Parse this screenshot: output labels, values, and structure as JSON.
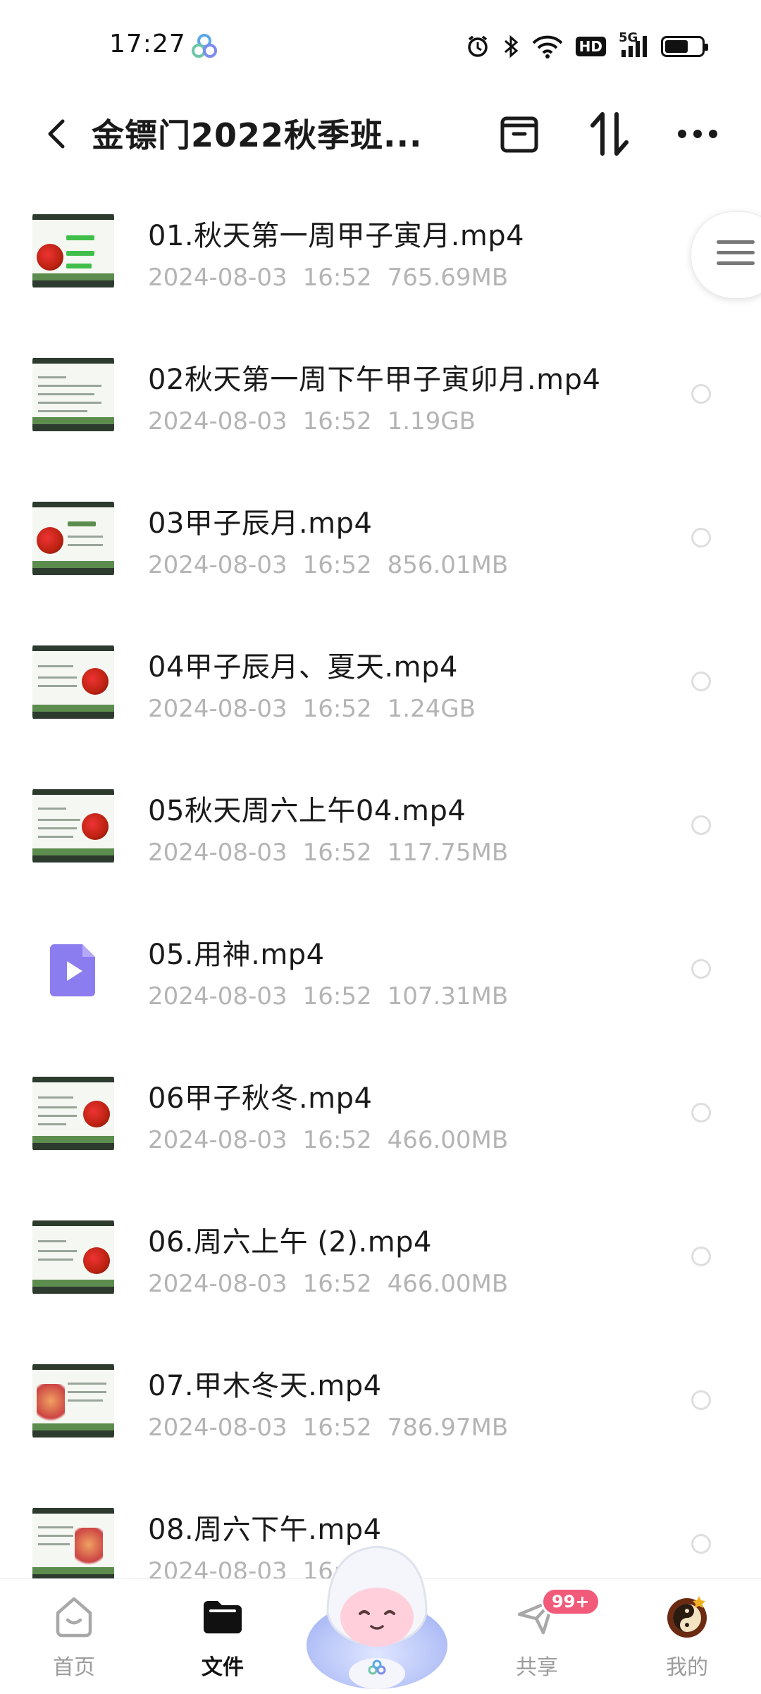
{
  "status_bar": {
    "time": "17:27",
    "network": "5G",
    "hd_label": "HD",
    "icons": [
      "alarm-icon",
      "bluetooth-icon",
      "wifi-icon",
      "hd-icon",
      "signal-icon",
      "battery-icon"
    ]
  },
  "header": {
    "title": "金镖门2022秋季班...",
    "buttons": [
      "back-icon",
      "archive-icon",
      "sort-icon",
      "more-icon"
    ]
  },
  "files": [
    {
      "name": "01.秋天第一周甲子寅月.mp4",
      "date": "2024-08-03",
      "time": "16:52",
      "size": "765.69MB",
      "thumb": "slide"
    },
    {
      "name": "02秋天第一周下午甲子寅卯月.mp4",
      "date": "2024-08-03",
      "time": "16:52",
      "size": "1.19GB",
      "thumb": "slide"
    },
    {
      "name": "03甲子辰月.mp4",
      "date": "2024-08-03",
      "time": "16:52",
      "size": "856.01MB",
      "thumb": "slide"
    },
    {
      "name": "04甲子辰月、夏天.mp4",
      "date": "2024-08-03",
      "time": "16:52",
      "size": "1.24GB",
      "thumb": "slide"
    },
    {
      "name": "05秋天周六上午04.mp4",
      "date": "2024-08-03",
      "time": "16:52",
      "size": "117.75MB",
      "thumb": "slide"
    },
    {
      "name": "05.用神.mp4",
      "date": "2024-08-03",
      "time": "16:52",
      "size": "107.31MB",
      "thumb": "video-icon"
    },
    {
      "name": "06甲子秋冬.mp4",
      "date": "2024-08-03",
      "time": "16:52",
      "size": "466.00MB",
      "thumb": "slide"
    },
    {
      "name": "06.周六上午 (2).mp4",
      "date": "2024-08-03",
      "time": "16:52",
      "size": "466.00MB",
      "thumb": "slide"
    },
    {
      "name": "07.甲木冬天.mp4",
      "date": "2024-08-03",
      "time": "16:52",
      "size": "786.97MB",
      "thumb": "slide"
    },
    {
      "name": "08.周六下午.mp4",
      "date": "2024-08-03",
      "time": "16:",
      "size": "",
      "thumb": "slide"
    }
  ],
  "bottom_nav": {
    "items": [
      {
        "label": "首页",
        "icon": "home-icon",
        "active": false
      },
      {
        "label": "文件",
        "icon": "folder-icon",
        "active": true
      },
      {
        "label": "共享",
        "icon": "share-icon",
        "active": false,
        "badge": "99+"
      },
      {
        "label": "我的",
        "icon": "profile-avatar",
        "active": false
      }
    ]
  },
  "colors": {
    "accent_purple": "#8b7cf0",
    "badge_pink": "#f25a7a",
    "meta_gray": "#b4b4b4"
  }
}
